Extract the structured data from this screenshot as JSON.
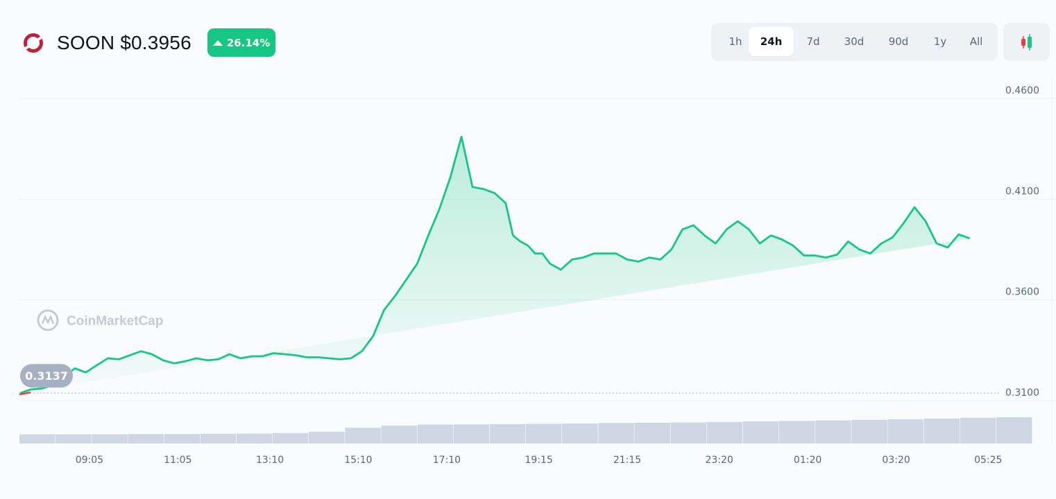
{
  "header": {
    "title": "SOON $0.3956",
    "change": "26.14%",
    "logo_icon": "ring-logo-icon",
    "up_icon": "triangle-up-icon",
    "candle_icon": "candlestick-icon"
  },
  "range_tabs": [
    {
      "label": "1h",
      "active": false
    },
    {
      "label": "24h",
      "active": true
    },
    {
      "label": "7d",
      "active": false
    },
    {
      "label": "30d",
      "active": false
    },
    {
      "label": "90d",
      "active": false
    },
    {
      "label": "1y",
      "active": false
    },
    {
      "label": "All",
      "active": false
    }
  ],
  "watermark": "CoinMarketCap",
  "colors": {
    "up": "#16c784",
    "down": "#ea3943",
    "logo": "#c0203a",
    "grid": "#eff2f5",
    "text_muted": "#58667e",
    "volume": "#cfd6e4"
  },
  "chart_data": {
    "type": "area",
    "ylim": [
      0.31,
      0.46
    ],
    "y_ticks": [
      "0.4600",
      "0.4100",
      "0.3600",
      "0.3100"
    ],
    "x_ticks": [
      "09:05",
      "11:05",
      "13:10",
      "15:10",
      "17:10",
      "19:15",
      "21:15",
      "23:20",
      "01:20",
      "03:20",
      "05:25"
    ],
    "open_label": "0.3137",
    "open_value": 0.3137,
    "x_range": [
      "07:30",
      "06:25"
    ],
    "x": [
      "07:30",
      "07:45",
      "08:00",
      "08:15",
      "08:30",
      "08:45",
      "09:00",
      "09:15",
      "09:30",
      "09:45",
      "10:00",
      "10:15",
      "10:30",
      "10:45",
      "11:00",
      "11:15",
      "11:30",
      "11:45",
      "12:00",
      "12:15",
      "12:30",
      "12:45",
      "13:00",
      "13:15",
      "13:30",
      "13:45",
      "14:00",
      "14:15",
      "14:30",
      "14:45",
      "15:00",
      "15:15",
      "15:30",
      "15:45",
      "16:00",
      "16:15",
      "16:30",
      "16:45",
      "17:00",
      "17:15",
      "17:30",
      "17:45",
      "18:00",
      "18:15",
      "18:30",
      "18:40",
      "18:50",
      "19:00",
      "19:10",
      "19:20",
      "19:30",
      "19:45",
      "20:00",
      "20:15",
      "20:30",
      "20:45",
      "21:00",
      "21:15",
      "21:30",
      "21:45",
      "22:00",
      "22:15",
      "22:30",
      "22:45",
      "23:00",
      "23:15",
      "23:30",
      "23:45",
      "00:00",
      "00:15",
      "00:30",
      "00:45",
      "01:00",
      "01:15",
      "01:30",
      "01:45",
      "02:00",
      "02:15",
      "02:30",
      "02:45",
      "03:00",
      "03:15",
      "03:30",
      "03:45",
      "04:00",
      "04:15",
      "04:30",
      "04:45",
      "05:00",
      "05:15",
      "05:30",
      "05:45",
      "06:00",
      "06:10",
      "06:25"
    ],
    "y": [
      0.3135,
      0.3155,
      0.316,
      0.3175,
      0.321,
      0.326,
      0.324,
      0.3275,
      0.331,
      0.3305,
      0.3325,
      0.3345,
      0.333,
      0.33,
      0.3285,
      0.3295,
      0.331,
      0.33,
      0.3305,
      0.333,
      0.331,
      0.332,
      0.332,
      0.3335,
      0.333,
      0.3325,
      0.3315,
      0.3315,
      0.331,
      0.3305,
      0.331,
      0.3345,
      0.342,
      0.355,
      0.362,
      0.37,
      0.378,
      0.392,
      0.405,
      0.421,
      0.441,
      0.416,
      0.415,
      0.413,
      0.408,
      0.392,
      0.389,
      0.387,
      0.383,
      0.383,
      0.378,
      0.375,
      0.38,
      0.381,
      0.383,
      0.383,
      0.383,
      0.38,
      0.379,
      0.381,
      0.38,
      0.385,
      0.395,
      0.397,
      0.392,
      0.388,
      0.395,
      0.399,
      0.395,
      0.388,
      0.392,
      0.39,
      0.387,
      0.382,
      0.382,
      0.381,
      0.3825,
      0.389,
      0.385,
      0.383,
      0.388,
      0.391,
      0.398,
      0.406,
      0.399,
      0.388,
      0.386,
      0.3925,
      0.3905
    ]
  },
  "volume_data": {
    "values": [
      0.35,
      0.35,
      0.35,
      0.36,
      0.36,
      0.37,
      0.38,
      0.4,
      0.45,
      0.6,
      0.68,
      0.72,
      0.73,
      0.74,
      0.75,
      0.76,
      0.78,
      0.79,
      0.8,
      0.82,
      0.84,
      0.86,
      0.88,
      0.9,
      0.92,
      0.95,
      0.98,
      1.0
    ]
  }
}
